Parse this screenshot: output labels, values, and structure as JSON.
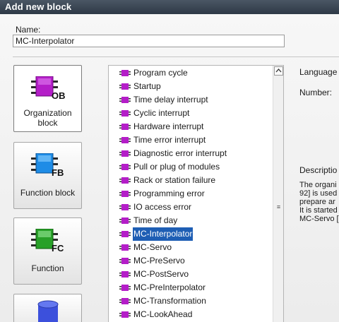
{
  "dialog": {
    "title": "Add new block"
  },
  "name_field": {
    "label": "Name:",
    "value": "MC-Interpolator"
  },
  "block_types": [
    {
      "label_line1": "Organization",
      "label_line2": "block",
      "icon_text": "OB",
      "icon_color": "#b41ec8"
    },
    {
      "label_line1": "Function block",
      "label_line2": "",
      "icon_text": "FB",
      "icon_color": "#1e8ce6"
    },
    {
      "label_line1": "Function",
      "label_line2": "",
      "icon_text": "FC",
      "icon_color": "#28a028"
    },
    {
      "label_line1": "",
      "label_line2": "",
      "icon_text": "",
      "icon_color": "#3c50dc"
    }
  ],
  "ob_list": {
    "items": [
      "Program cycle",
      "Startup",
      "Time delay interrupt",
      "Cyclic interrupt",
      "Hardware interrupt",
      "Time error interrupt",
      "Diagnostic error interrupt",
      "Pull or plug of modules",
      "Rack or station failure",
      "Programming error",
      "IO access error",
      "Time of day",
      "MC-Interpolator",
      "MC-Servo",
      "MC-PreServo",
      "MC-PostServo",
      "MC-PreInterpolator",
      "MC-Transformation",
      "MC-LookAhead"
    ],
    "selected": "MC-Interpolator",
    "icon_color": "#b41ec8"
  },
  "properties": {
    "language_label": "Language",
    "number_label": "Number:",
    "description_label": "Descriptio",
    "description_lines": [
      "The organi",
      "92] is used",
      "prepare ar",
      "It is started",
      "MC-Servo ["
    ]
  }
}
